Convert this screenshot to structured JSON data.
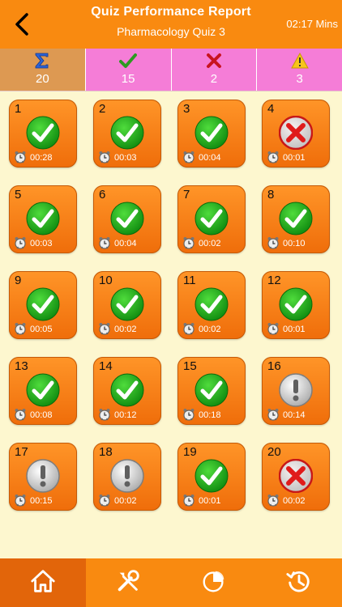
{
  "header": {
    "title": "Quiz Performance Report",
    "subtitle": "Pharmacology Quiz 3",
    "timer": "02:17 Mins",
    "back_icon": "back-chevron-icon"
  },
  "stats": {
    "total": "20",
    "correct": "15",
    "wrong": "2",
    "skipped": "3"
  },
  "colors": {
    "header": "#f98a10",
    "background": "#fdf7cf",
    "stats_bar": "#f57dd7",
    "total_cell": "#dd9952",
    "correct": "#1ca21c",
    "wrong": "#e01b1b",
    "skipped": "#9e9e9e"
  },
  "questions": [
    {
      "num": "1",
      "status": "correct",
      "time": "00:28"
    },
    {
      "num": "2",
      "status": "correct",
      "time": "00:03"
    },
    {
      "num": "3",
      "status": "correct",
      "time": "00:04"
    },
    {
      "num": "4",
      "status": "wrong",
      "time": "00:01"
    },
    {
      "num": "5",
      "status": "correct",
      "time": "00:03"
    },
    {
      "num": "6",
      "status": "correct",
      "time": "00:04"
    },
    {
      "num": "7",
      "status": "correct",
      "time": "00:02"
    },
    {
      "num": "8",
      "status": "correct",
      "time": "00:10"
    },
    {
      "num": "9",
      "status": "correct",
      "time": "00:05"
    },
    {
      "num": "10",
      "status": "correct",
      "time": "00:02"
    },
    {
      "num": "11",
      "status": "correct",
      "time": "00:02"
    },
    {
      "num": "12",
      "status": "correct",
      "time": "00:01"
    },
    {
      "num": "13",
      "status": "correct",
      "time": "00:08"
    },
    {
      "num": "14",
      "status": "correct",
      "time": "00:12"
    },
    {
      "num": "15",
      "status": "correct",
      "time": "00:18"
    },
    {
      "num": "16",
      "status": "skipped",
      "time": "00:14"
    },
    {
      "num": "17",
      "status": "skipped",
      "time": "00:15"
    },
    {
      "num": "18",
      "status": "skipped",
      "time": "00:02"
    },
    {
      "num": "19",
      "status": "correct",
      "time": "00:01"
    },
    {
      "num": "20",
      "status": "wrong",
      "time": "00:02"
    }
  ],
  "tabbar": [
    {
      "icon": "home-icon",
      "active": true
    },
    {
      "icon": "tools-icon",
      "active": false
    },
    {
      "icon": "pie-chart-icon",
      "active": false
    },
    {
      "icon": "history-icon",
      "active": false
    }
  ]
}
